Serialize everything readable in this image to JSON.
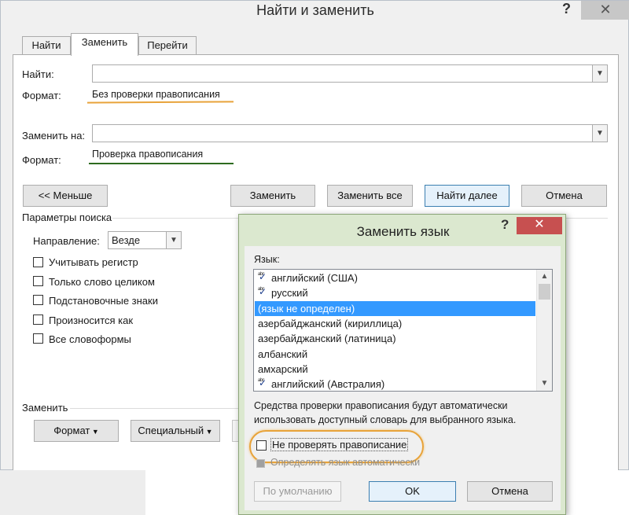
{
  "main": {
    "title": "Найти и заменить",
    "help": "?",
    "close": "✕",
    "tabs": [
      "Найти",
      "Заменить",
      "Перейти"
    ],
    "find_label": "Найти:",
    "find_value": "",
    "find_format_label": "Формат:",
    "find_format_value": "Без проверки правописания",
    "replace_label": "Заменить на:",
    "replace_value": "",
    "replace_format_label": "Формат:",
    "replace_format_value": "Проверка правописания",
    "buttons": {
      "less": "<< Меньше",
      "replace": "Заменить",
      "replace_all": "Заменить все",
      "find_next": "Найти далее",
      "cancel": "Отмена"
    },
    "search_params_label": "Параметры поиска",
    "direction_label": "Направление:",
    "direction_value": "Везде",
    "options": [
      "Учитывать регистр",
      "Только слово целиком",
      "Подстановочные знаки",
      "Произносится как",
      "Все словоформы"
    ],
    "replace_group_label": "Заменить",
    "format_button": "Формат",
    "special_button": "Специальный"
  },
  "lang_dialog": {
    "title": "Заменить язык",
    "help": "?",
    "close": "✕",
    "language_label": "Язык:",
    "languages": [
      {
        "name": "английский (США)",
        "spell": true
      },
      {
        "name": "русский",
        "spell": true
      },
      {
        "name": "(язык не определен)",
        "spell": false,
        "selected": true
      },
      {
        "name": "азербайджанский (кириллица)",
        "spell": false
      },
      {
        "name": "азербайджанский (латиница)",
        "spell": false
      },
      {
        "name": "албанский",
        "spell": false
      },
      {
        "name": "амхарский",
        "spell": false
      },
      {
        "name": "английский (Австралия)",
        "spell": true
      }
    ],
    "hint": "Средства проверки правописания будут автоматически использовать доступный словарь для выбранного языка.",
    "no_spellcheck": "Не проверять правописание",
    "auto_detect": "Определять язык автоматически",
    "buttons": {
      "default": "По умолчанию",
      "ok": "OK",
      "cancel": "Отмена"
    }
  },
  "colors": {
    "orange_underline": "#e8a33a",
    "green_underline": "#2e6b1f",
    "selected_item": "#3399ff",
    "lang_dialog_frame": "#dbe8cf",
    "close_button": "#c75050"
  }
}
